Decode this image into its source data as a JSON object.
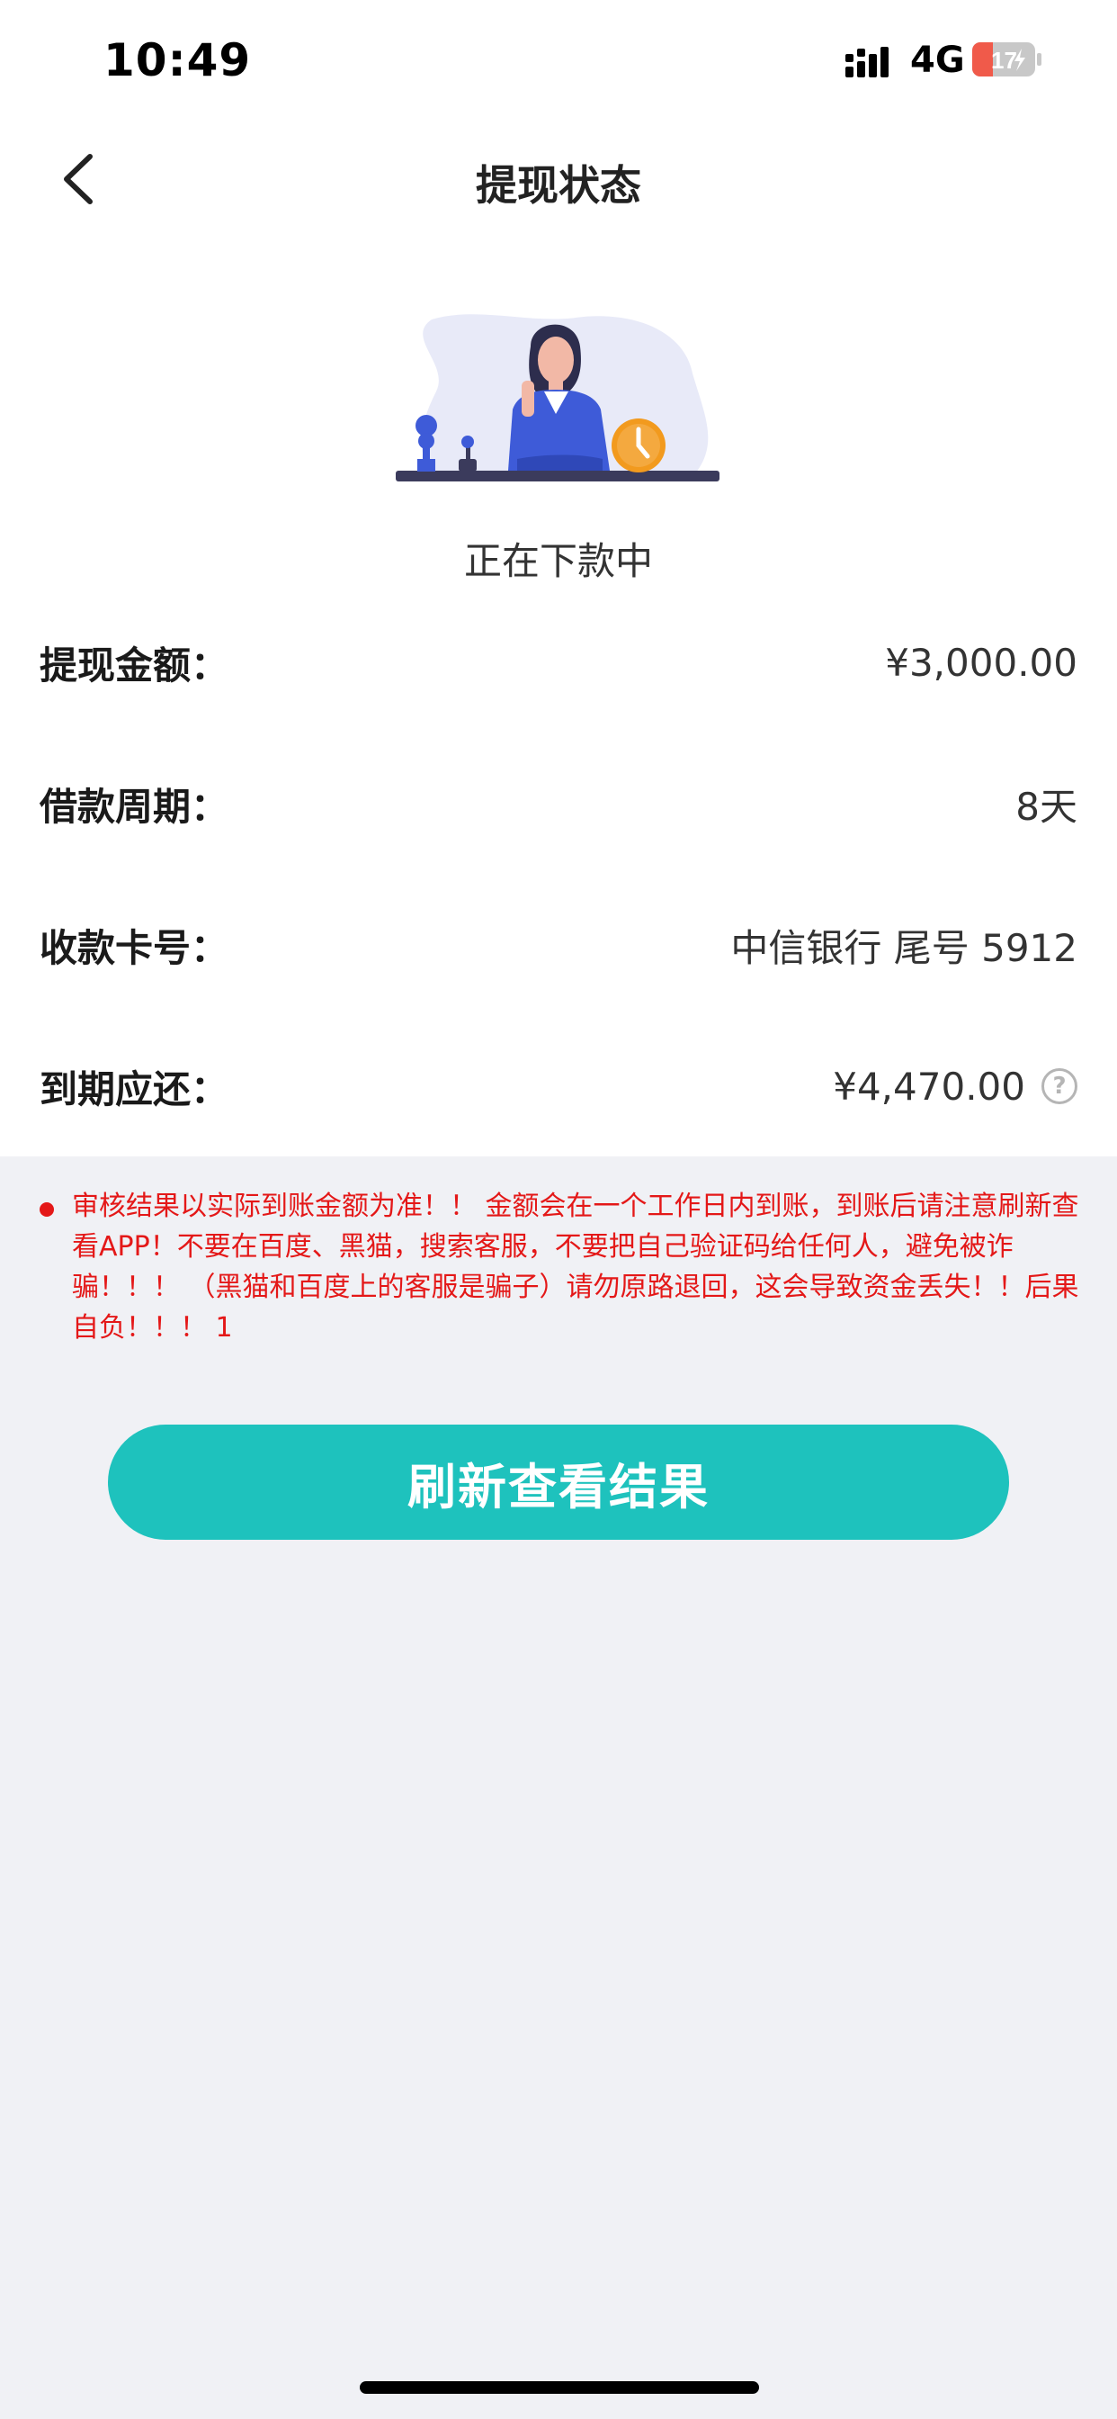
{
  "status_bar": {
    "time": "10:49",
    "network": "4G",
    "battery": "17"
  },
  "nav": {
    "title": "提现状态",
    "back_icon": "chevron-left-icon"
  },
  "status": {
    "text": "正在下款中",
    "illustration": "woman-waiting-clock"
  },
  "rows": [
    {
      "label": "提现金额：",
      "value": "¥3,000.00"
    },
    {
      "label": "借款周期：",
      "value": "8天"
    },
    {
      "label": "收款卡号：",
      "value": "中信银行 尾号 5912"
    },
    {
      "label": "到期应还：",
      "value": "¥4,470.00"
    }
  ],
  "notice": {
    "text": "审核结果以实际到账金额为准！！ 金额会在一个工作日内到账，到账后请注意刷新查看APP！不要在百度、黑猫，搜索客服，不要把自己验证码给任何人，避免被诈骗！！！ （黑猫和百度上的客服是骗子）请勿原路退回，这会导致资金丢失！！后果自负！！！   1"
  },
  "refresh_button": {
    "label": "刷新查看结果"
  },
  "colors": {
    "accent": "#1ec2bd",
    "warning": "#e41818",
    "background": "#f0f1f5"
  }
}
